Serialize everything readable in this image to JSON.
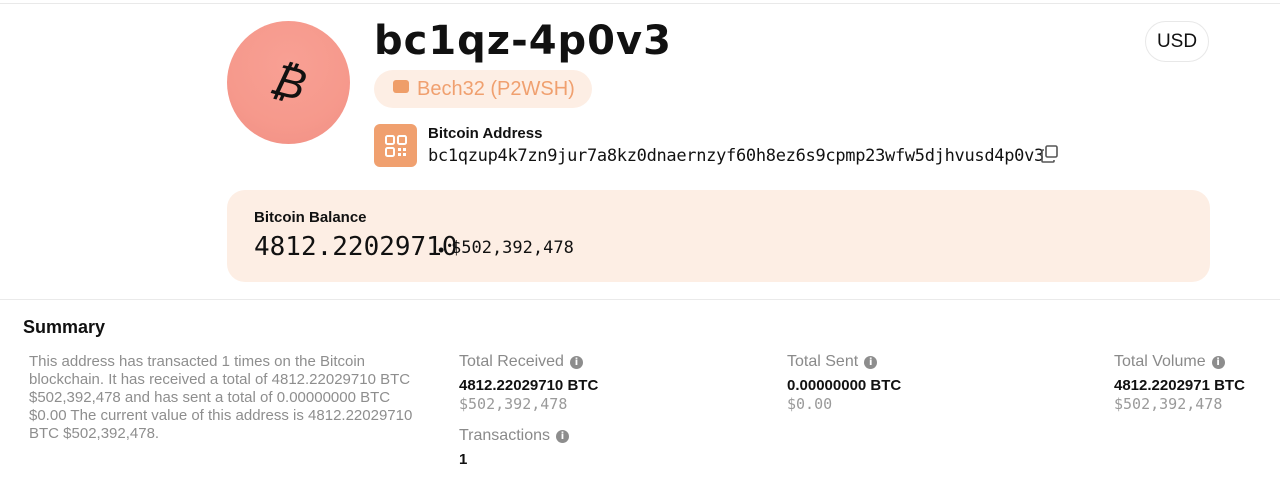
{
  "header": {
    "title": "bc1qz-4p0v3",
    "badge": "Bech32 (P2WSH)",
    "currency": "USD",
    "avatar_glyph": "₿"
  },
  "address": {
    "label": "Bitcoin Address",
    "value": "bc1qzup4k7zn9jur7a8kz0dnaernzyf60h8ez6s9cpmp23wfw5djhvusd4p0v3"
  },
  "balance": {
    "label": "Bitcoin Balance",
    "btc": "4812.22029710",
    "separator": "•",
    "usd": "$502,392,478"
  },
  "summary": {
    "heading": "Summary",
    "text": "This address has transacted 1 times on the Bitcoin blockchain. It has received a total of 4812.22029710 BTC $502,392,478 and has sent a total of 0.00000000 BTC $0.00 The current value of this address is 4812.22029710 BTC $502,392,478.",
    "stats": {
      "received": {
        "label": "Total Received",
        "value": "4812.22029710 BTC",
        "usd": "$502,392,478"
      },
      "sent": {
        "label": "Total Sent",
        "value": "0.00000000 BTC",
        "usd": "$0.00"
      },
      "volume": {
        "label": "Total Volume",
        "value": "4812.2202971 BTC",
        "usd": "$502,392,478"
      },
      "transactions": {
        "label": "Transactions",
        "value": "1"
      }
    }
  },
  "colors": {
    "accent": "#f0a06f",
    "avatar": "#f6998c",
    "card_bg": "#fdeee4"
  },
  "icons": [
    "bitcoin-icon",
    "wallet-icon",
    "qr-code-icon",
    "copy-icon",
    "info-icon"
  ]
}
